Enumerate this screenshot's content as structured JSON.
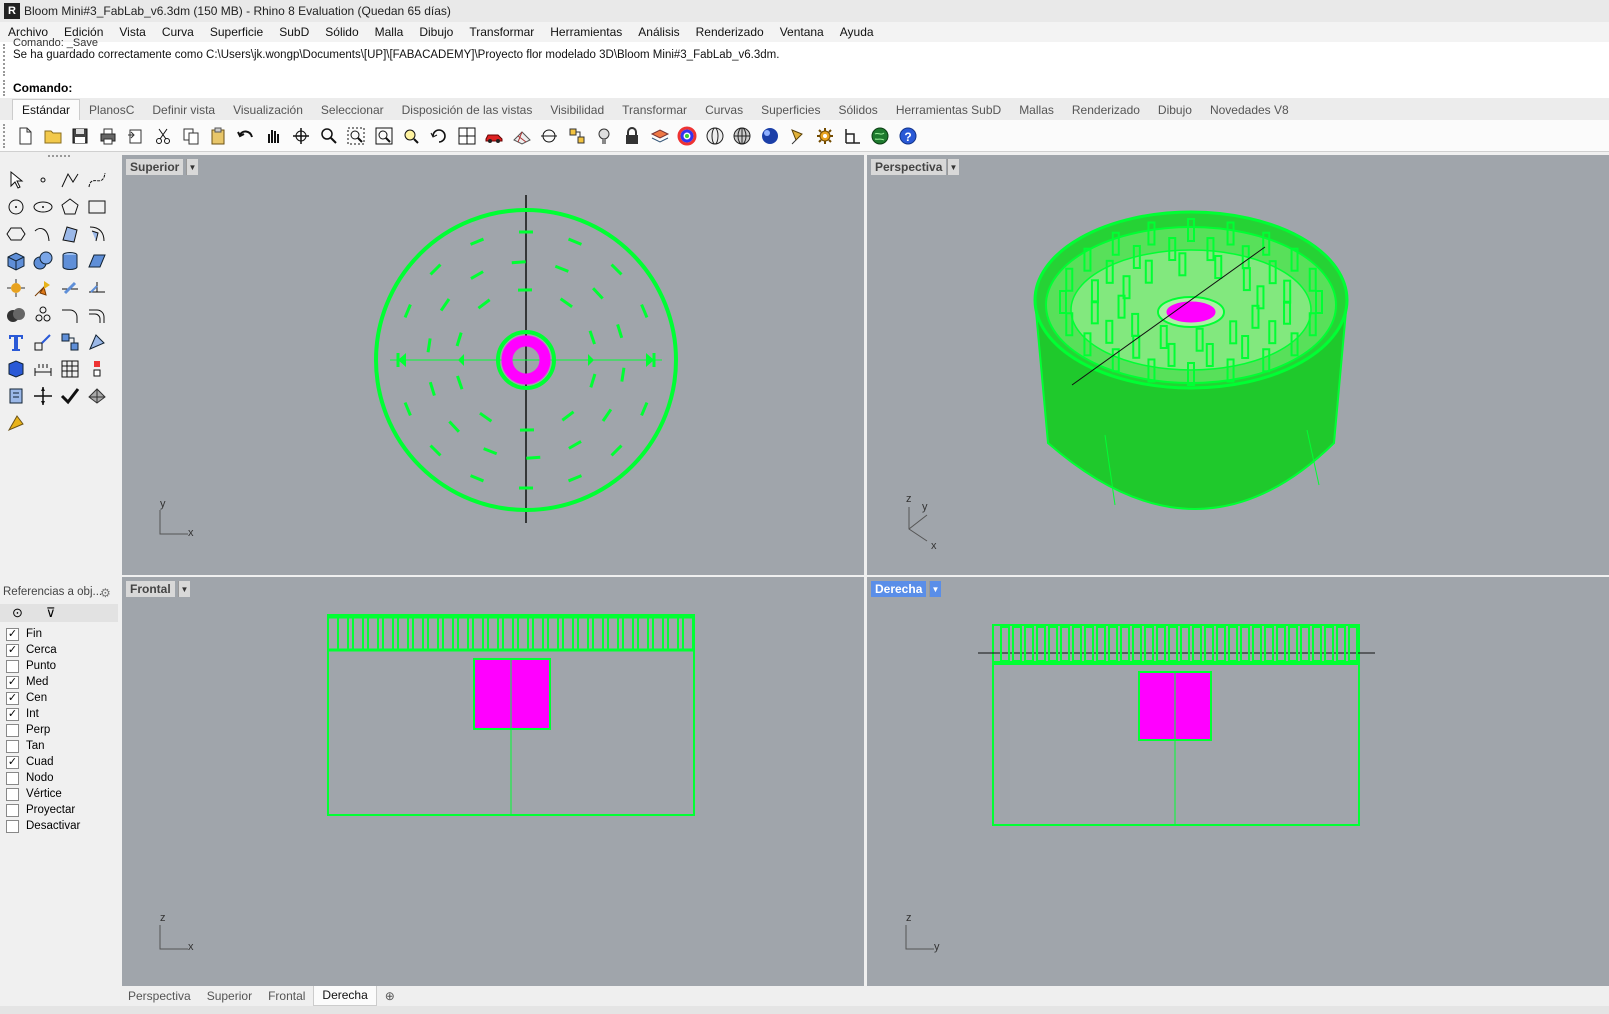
{
  "window": {
    "title": "Bloom Mini#3_FabLab_v6.3dm (150 MB) - Rhino 8 Evaluation (Quedan 65 días)"
  },
  "menu": [
    "Archivo",
    "Edición",
    "Vista",
    "Curva",
    "Superficie",
    "SubD",
    "Sólido",
    "Malla",
    "Dibujo",
    "Transformar",
    "Herramientas",
    "Análisis",
    "Renderizado",
    "Ventana",
    "Ayuda"
  ],
  "command": {
    "previous": "Comando: _Save",
    "history": "Se ha guardado correctamente como C:\\Users\\jk.wongp\\Documents\\[UP]\\[FABACADEMY]\\Proyecto flor modelado 3D\\Bloom Mini#3_FabLab_v6.3dm.",
    "prompt": "Comando:",
    "value": ""
  },
  "toolbar_tabs": [
    "Estándar",
    "PlanosC",
    "Definir vista",
    "Visualización",
    "Seleccionar",
    "Disposición de las vistas",
    "Visibilidad",
    "Transformar",
    "Curvas",
    "Superficies",
    "Sólidos",
    "Herramientas SubD",
    "Mallas",
    "Renderizado",
    "Dibujo",
    "Novedades V8"
  ],
  "toolbar_icons": [
    "new-icon",
    "open-icon",
    "save-icon",
    "print-icon",
    "import-icon",
    "cut-icon",
    "copy-icon",
    "paste-icon",
    "undo-icon",
    "pan-icon",
    "rotate-view-icon",
    "zoom-icon",
    "zoom-window-icon",
    "zoom-extents-icon",
    "zoom-selected-icon",
    "undo-view-icon",
    "four-viewports-icon",
    "car-icon",
    "grid-icon",
    "osnap-icon",
    "properties-icon",
    "light-icon",
    "lock-icon",
    "layers-icon",
    "color-wheel-icon",
    "wireframe-sphere-icon",
    "grid-sphere-icon",
    "render-sphere-icon",
    "pen-icon",
    "gear-icon",
    "dimension-icon",
    "globe-icon",
    "help-icon"
  ],
  "osnap": {
    "header": "Referencias a obj...",
    "items": [
      {
        "label": "Fin",
        "checked": true
      },
      {
        "label": "Cerca",
        "checked": true
      },
      {
        "label": "Punto",
        "checked": false
      },
      {
        "label": "Med",
        "checked": true
      },
      {
        "label": "Cen",
        "checked": true
      },
      {
        "label": "Int",
        "checked": true
      },
      {
        "label": "Perp",
        "checked": false
      },
      {
        "label": "Tan",
        "checked": false
      },
      {
        "label": "Cuad",
        "checked": true
      },
      {
        "label": "Nodo",
        "checked": false
      },
      {
        "label": "Vértice",
        "checked": false
      },
      {
        "label": "Proyectar",
        "checked": false
      },
      {
        "label": "Desactivar",
        "checked": false
      }
    ]
  },
  "viewports": {
    "top": {
      "label": "Superior",
      "axis1": "y",
      "axis2": "x"
    },
    "perspective": {
      "label": "Perspectiva",
      "axis1": "z",
      "axis2": "y",
      "axis3": "x"
    },
    "front": {
      "label": "Frontal",
      "axis1": "z",
      "axis2": "x"
    },
    "right": {
      "label": "Derecha",
      "axis1": "z",
      "axis2": "y"
    }
  },
  "bottom_tabs": [
    "Perspectiva",
    "Superior",
    "Frontal",
    "Derecha"
  ],
  "colors": {
    "wire": "#00ff33",
    "selected": "#ff00ff",
    "viewport_bg": "#a0a5ab",
    "active_label": "#5a8ee8"
  }
}
